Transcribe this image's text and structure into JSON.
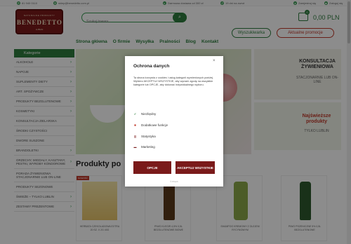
{
  "topbar": {
    "phone": "81 940 0110",
    "email": "sklep@benedetto.com.pl",
    "free_shipping": "Darmowa dostawa od 300 zł",
    "delivery": "19 dni na zwrot",
    "register": "Zarejestruj się",
    "login": "Zaloguj się"
  },
  "logo": {
    "line1": "NATURALNE PRODUKTY",
    "name": "BENEDETTO",
    "line3": "LUBLIN"
  },
  "search": {
    "placeholder": "Szukaj towaru..."
  },
  "cart": {
    "amount": "0,00 PLN",
    "count": "0"
  },
  "pills": {
    "search_label": "Wyszukiwarka",
    "promo_label": "Aktualne promocje"
  },
  "nav": [
    "Strona główna",
    "O firmie",
    "Wysyłka",
    "Pralności",
    "Blog",
    "Kontakt"
  ],
  "sidebar": {
    "header": "Kategorie",
    "items": [
      "ALKOHOLE",
      "NAPOJE",
      "SUPLEMENTY DIETY",
      "ART. SPOŻYWCZE",
      "PRODUKTY BEZGLUTENOWE",
      "KOSMETYKI",
      "KONSULTACJA ZIELARSKA",
      "ŚRODKI CZYSTOŚCI",
      "DWORE SUSZONE",
      "BRANDOLETKI",
      "ORZECHY, MIGDAŁY, KASZTANY, PESTKI, WYROBY KONDOROWE",
      "PORADA ŻYWIENIOWA STACJONARNIE LUB ON-LINE",
      "PRODUKTY SEZONOWE",
      "ŚWIEŻE – TYLKO LUBLIN",
      "ZESTAWY PREZENTOWE"
    ]
  },
  "ads": {
    "ad1_title": "KONSULTACJA ŻYWIENIOWA",
    "ad1_sub": "STACJONARNIE LUB ON-LINE",
    "ad2_title": "Najświeższe produkty",
    "ad2_sub": "TYLKO LUBLIN"
  },
  "products": {
    "title": "Produkty po",
    "items": [
      {
        "name": "HERBATA CZEKOLADOWA EXTRA 20 SZ. X 2G 40G",
        "tag": "NOWOŚĆ"
      },
      {
        "name": "PIWO KLEGIR 4,5% 0,5L BEZGLUTENOWE BIOWE",
        "tag": ""
      },
      {
        "name": "SHAMPOO KREMOWY Z OLEJEM RYCYNOWYM",
        "tag": ""
      },
      {
        "name": "PIWO PSZENICZNE 5% 0,5L BEZGLUTENOWE",
        "tag": ""
      }
    ]
  },
  "modal": {
    "title": "Ochrona danych",
    "close": "×",
    "text": "Ta strona korzysta z cookies i usług kategorii wymienionych poniżej. Wybierz AKCEPTUJ WSZYSTKIE, aby wyrazić zgodę na wszystkie kategorie lub OPCJE, aby dokonać indywidualnego wyboru.",
    "options": [
      {
        "label": "Niezbędny",
        "icon": "check-icon",
        "color": "#2e7d3e"
      },
      {
        "label": "Dodatkowe funkcje",
        "icon": "gear-icon",
        "color": "#c0392b"
      },
      {
        "label": "Statystyka",
        "icon": "chart-icon",
        "color": "#7a1a1a"
      },
      {
        "label": "Marketing",
        "icon": "megaphone-icon",
        "color": "#7a1a1a"
      }
    ],
    "btn_options": "OPCJE",
    "btn_accept": "AKCEPTUJ WSZYSTKIE",
    "footer": "© Pirsch"
  },
  "colors": {
    "brand_green": "#2e7d3e",
    "brand_red": "#7a1a1a"
  }
}
